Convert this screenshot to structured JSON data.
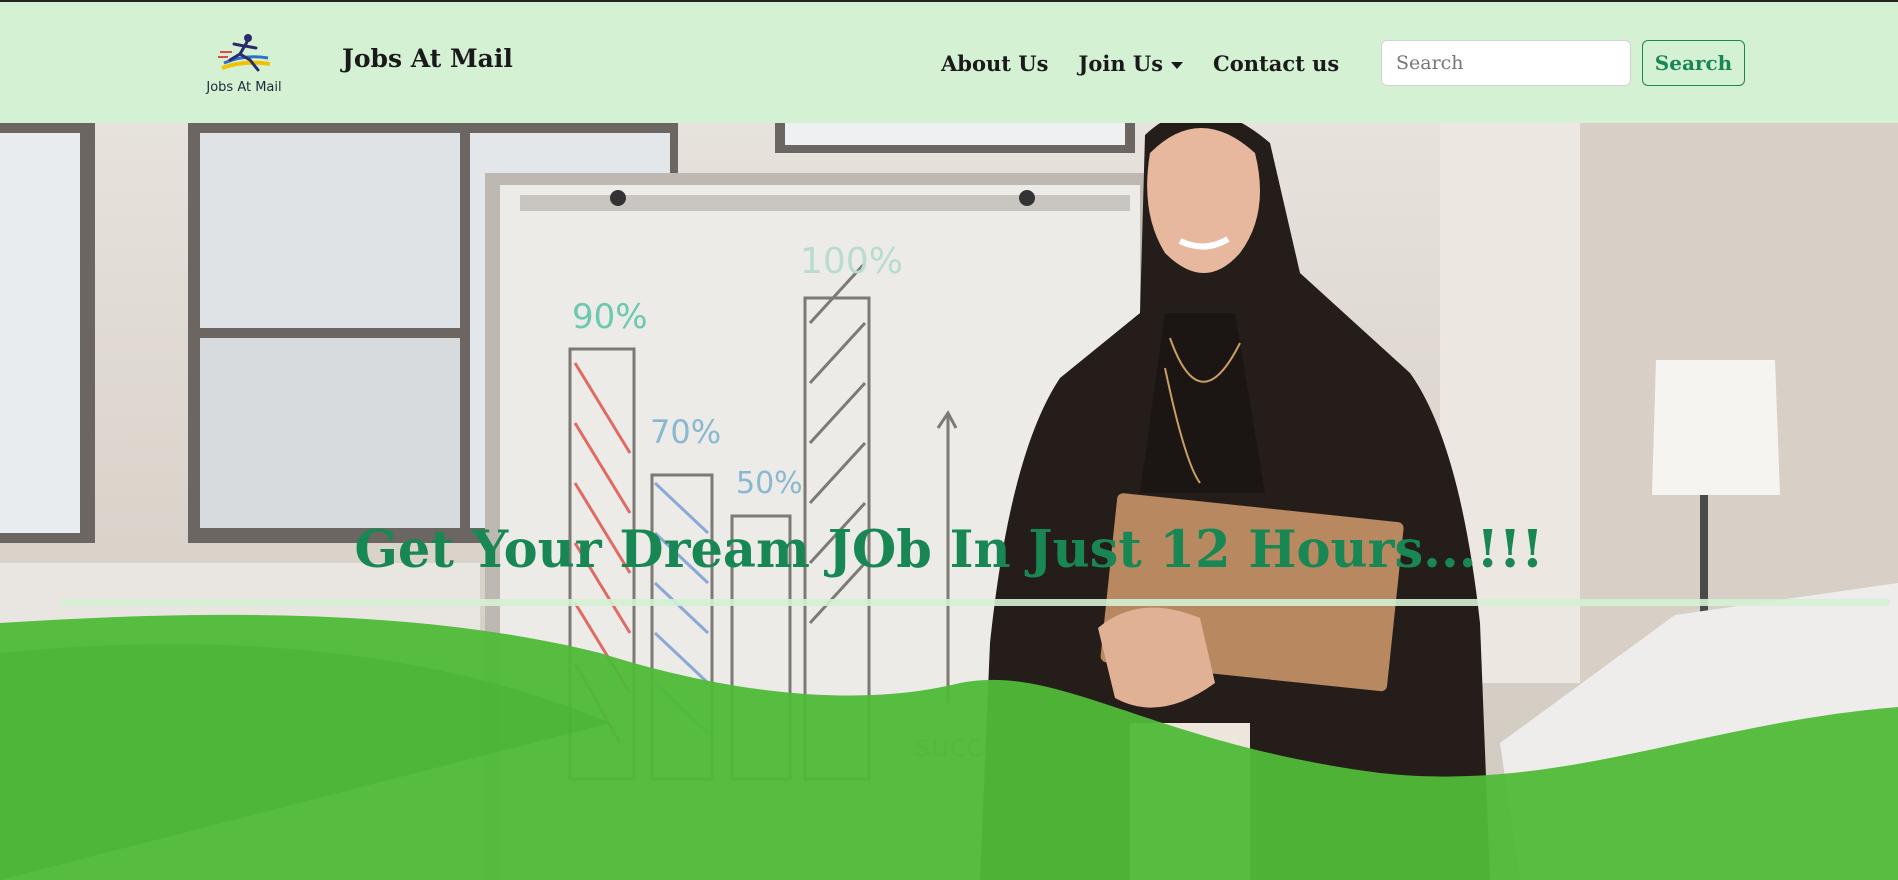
{
  "brand": {
    "logo_text": "Jobs At Mail",
    "name": "Jobs At Mail"
  },
  "nav": {
    "about": "About Us",
    "join": "Join Us",
    "contact": "Contact us"
  },
  "search": {
    "placeholder": "Search",
    "button": "Search"
  },
  "hero": {
    "title": "Get Your Dream JOb In Just 12 Hours...!!!"
  },
  "colors": {
    "navbar_bg": "#d4f1d4",
    "accent": "#198754",
    "wave": "#4fba38"
  },
  "hero_image": {
    "whiteboard_labels": [
      "90%",
      "70%",
      "50%",
      "100%",
      "succ"
    ]
  }
}
